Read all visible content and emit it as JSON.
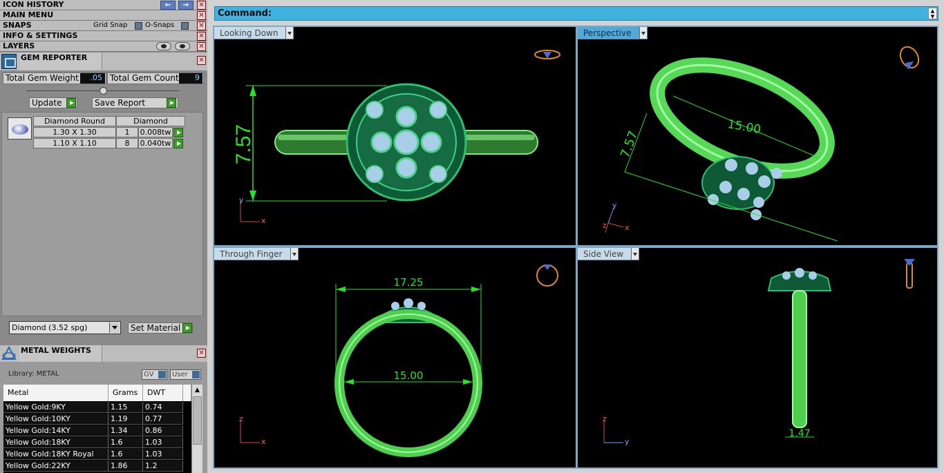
{
  "left_menus": {
    "icon_history": "ICON HISTORY",
    "main_menu": "MAIN MENU",
    "snaps": "SNAPS",
    "grid_snap": "Grid Snap",
    "o_snaps": "O-Snaps",
    "info_settings": "INFO & SETTINGS",
    "layers": "LAYERS",
    "close_symbol": "✕",
    "back_arrow": "←",
    "forward_arrow": "→"
  },
  "gem_reporter": {
    "title": "GEM REPORTER",
    "total_weight_label": "Total Gem Weight",
    "total_weight_value": ".05",
    "total_count_label": "Total Gem Count",
    "total_count_value": "9",
    "update_label": "Update",
    "save_report_label": "Save Report",
    "table_headers": [
      "Diamond Round",
      "Diamond"
    ],
    "rows": [
      {
        "size": "1.30 X 1.30",
        "count": "1",
        "weight": "0.008tw"
      },
      {
        "size": "1.10 X 1.10",
        "count": "8",
        "weight": "0.040tw"
      }
    ],
    "material_value": "Diamond     (3.52 spg)",
    "set_material_label": "Set Material"
  },
  "metal_weights": {
    "title": "METAL WEIGHTS",
    "library_label": "Library: METAL",
    "gv_label": "GV",
    "user_label": "User",
    "headers": [
      "Metal",
      "Grams",
      "DWT"
    ],
    "rows": [
      {
        "metal": "Yellow Gold:9KY",
        "grams": "1.15",
        "dwt": "0.74"
      },
      {
        "metal": "Yellow Gold:10KY",
        "grams": "1.19",
        "dwt": "0.77"
      },
      {
        "metal": "Yellow Gold:14KY",
        "grams": "1.34",
        "dwt": "0.86"
      },
      {
        "metal": "Yellow Gold:18KY",
        "grams": "1.6",
        "dwt": "1.03"
      },
      {
        "metal": "Yellow Gold:18KY Royal",
        "grams": "1.6",
        "dwt": "1.03"
      },
      {
        "metal": "Yellow Gold:22KY",
        "grams": "1.86",
        "dwt": "1.2"
      }
    ]
  },
  "command": {
    "label": "Command:"
  },
  "viewports": {
    "top_left": {
      "name": "Looking Down",
      "dimension": "7.57",
      "axis_v": "y",
      "axis_h": "x"
    },
    "top_right": {
      "name": "Perspective",
      "dim_long": "15.00",
      "dim_height": "7.57",
      "axis_v": "y",
      "axis_h": "x",
      "axis_z": "z"
    },
    "bottom_left": {
      "name": "Through Finger",
      "dim_outer": "17.25",
      "dim_inner": "15.00",
      "axis_v": "z",
      "axis_h": "x"
    },
    "bottom_right": {
      "name": "Side View",
      "dim_band": "1.47",
      "axis_v": "z",
      "axis_h": "y"
    }
  },
  "colors": {
    "ring_green": "#5ee85a",
    "dimension_green": "#27e327",
    "stone_blue": "#b8d8f0",
    "active_tab": "#52a9d8",
    "command_bar": "#40b2e0"
  }
}
